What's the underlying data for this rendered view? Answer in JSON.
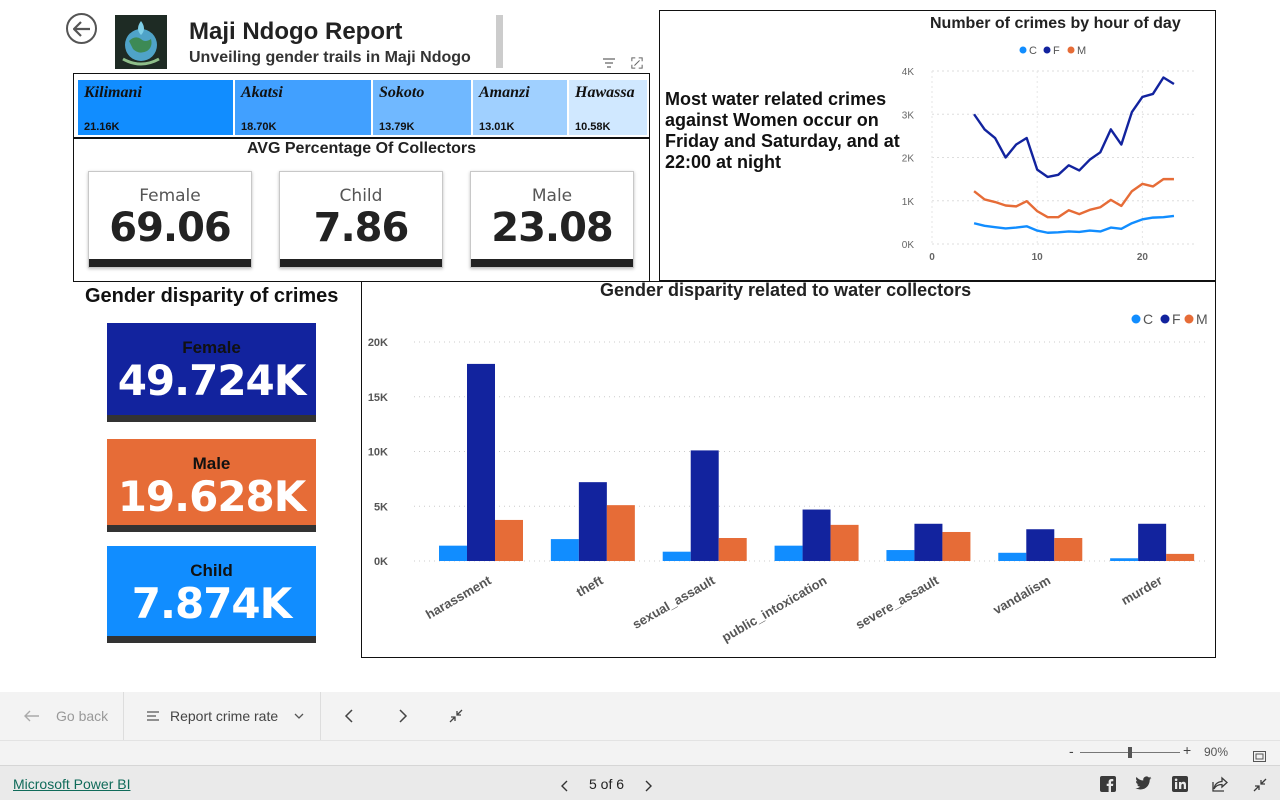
{
  "header": {
    "title": "Maji Ndogo Report",
    "subtitle": "Unveiling gender trails in Maji Ndogo"
  },
  "treemap": {
    "items": [
      {
        "name": "Kilimani",
        "value": "21.16K",
        "color": "#118dff"
      },
      {
        "name": "Akatsi",
        "value": "18.70K",
        "color": "#41a0ff"
      },
      {
        "name": "Sokoto",
        "value": "13.79K",
        "color": "#70b8ff"
      },
      {
        "name": "Amanzi",
        "value": "13.01K",
        "color": "#a0d0ff"
      },
      {
        "name": "Hawassa",
        "value": "10.58K",
        "color": "#d0e8ff"
      }
    ]
  },
  "avg_collectors": {
    "title": "AVG Percentage Of Collectors",
    "cards": [
      {
        "label": "Female",
        "value": "69.06"
      },
      {
        "label": "Child",
        "value": "7.86"
      },
      {
        "label": "Male",
        "value": "23.08"
      }
    ]
  },
  "line_panel": {
    "note": "Most water related crimes against Women occur on Friday and Saturday, and at 22:00 at night"
  },
  "gender_disparity": {
    "title": "Gender disparity of crimes",
    "kpis": [
      {
        "label": "Female",
        "value": "49.724K",
        "color": "#12239e",
        "text_color": "#ffffff",
        "label_color": "#111111"
      },
      {
        "label": "Male",
        "value": "19.628K",
        "color": "#e66c37",
        "text_color": "#ffffff",
        "label_color": "#111111"
      },
      {
        "label": "Child",
        "value": "7.874K",
        "color": "#118dff",
        "text_color": "#ffffff",
        "label_color": "#111111"
      }
    ]
  },
  "toolbar": {
    "go_back": "Go back",
    "page_select": "Report crime rate"
  },
  "zoom": {
    "minus": "-",
    "plus": "+",
    "value": "90%",
    "level": 0.5
  },
  "footer": {
    "brand": "Microsoft Power BI",
    "pagination": "5 of 6"
  },
  "chart_data": [
    {
      "type": "line",
      "title": "Number of crimes by hour of day",
      "legend": [
        "C",
        "F",
        "M"
      ],
      "legend_position": "top-center",
      "x_ticks": [
        "0",
        "10",
        "20"
      ],
      "y_ticks": [
        "0K",
        "1K",
        "2K",
        "3K",
        "4K"
      ],
      "xlim": [
        0,
        25
      ],
      "ylim": [
        0,
        4000
      ],
      "x": [
        4,
        5,
        6,
        7,
        8,
        9,
        10,
        11,
        12,
        13,
        14,
        15,
        16,
        17,
        18,
        19,
        20,
        21,
        22,
        23
      ],
      "series": [
        {
          "name": "C",
          "color": "#118dff",
          "values": [
            480,
            420,
            390,
            360,
            380,
            410,
            310,
            260,
            270,
            290,
            280,
            310,
            290,
            380,
            350,
            480,
            570,
            610,
            620,
            650
          ]
        },
        {
          "name": "F",
          "color": "#12239e",
          "values": [
            3000,
            2650,
            2450,
            2000,
            2300,
            2450,
            1720,
            1550,
            1600,
            1820,
            1700,
            1950,
            2120,
            2650,
            2300,
            3050,
            3400,
            3470,
            3850,
            3700
          ]
        },
        {
          "name": "M",
          "color": "#e66c37",
          "values": [
            1220,
            1030,
            970,
            890,
            870,
            990,
            760,
            620,
            620,
            780,
            690,
            790,
            850,
            1020,
            880,
            1220,
            1390,
            1330,
            1500,
            1500
          ]
        }
      ],
      "grid": true
    },
    {
      "type": "bar",
      "title": "Gender disparity related to water collectors",
      "legend": [
        "C",
        "F",
        "M"
      ],
      "legend_position": "top-right",
      "categories": [
        "harassment",
        "theft",
        "sexual_assault",
        "public_intoxication",
        "severe_assault",
        "vandalism",
        "murder"
      ],
      "y_ticks": [
        "0K",
        "5K",
        "10K",
        "15K",
        "20K"
      ],
      "ylim": [
        0,
        20000
      ],
      "series": [
        {
          "name": "C",
          "color": "#118dff",
          "values": [
            1400,
            2000,
            850,
            1400,
            1000,
            750,
            250
          ]
        },
        {
          "name": "F",
          "color": "#12239e",
          "values": [
            18000,
            7200,
            10100,
            4700,
            3400,
            2900,
            3400
          ]
        },
        {
          "name": "M",
          "color": "#e66c37",
          "values": [
            3750,
            5100,
            2100,
            3300,
            2650,
            2100,
            650
          ]
        }
      ],
      "grid": true
    }
  ]
}
